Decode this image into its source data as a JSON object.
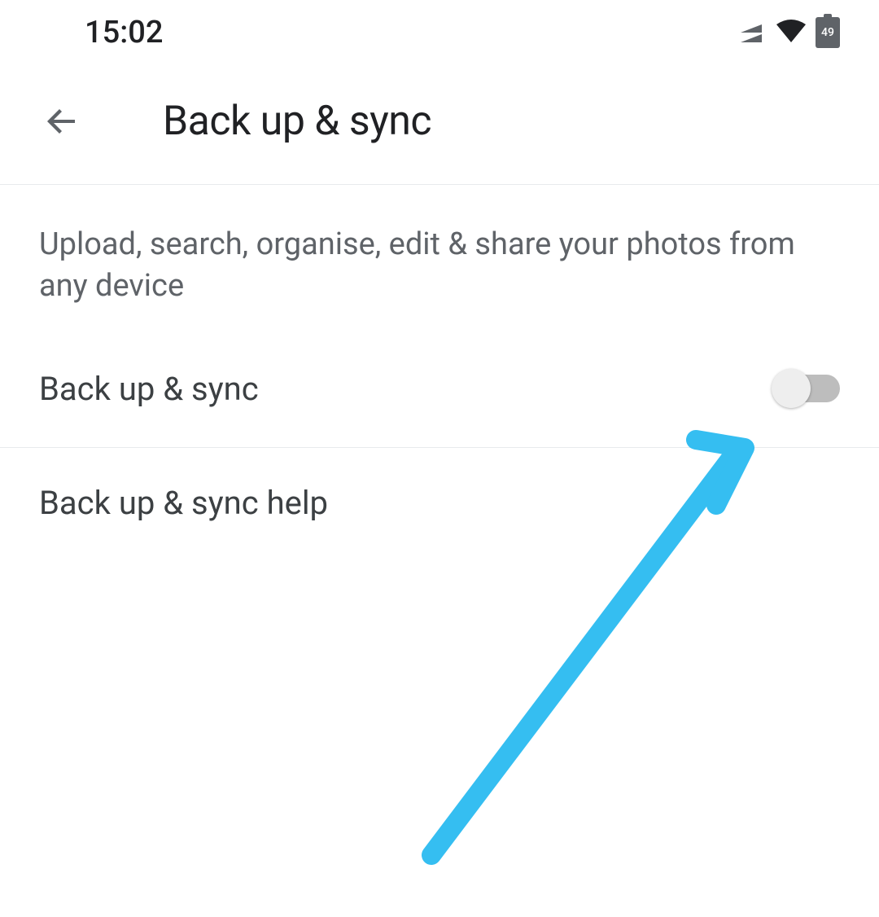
{
  "status_bar": {
    "time": "15:02",
    "battery_level": "49"
  },
  "app_bar": {
    "title": "Back up & sync"
  },
  "content": {
    "description": "Upload, search, organise, edit & share your photos from any device",
    "backup_toggle_label": "Back up & sync",
    "help_label": "Back up & sync help"
  },
  "colors": {
    "annotation_arrow": "#35bef1"
  }
}
